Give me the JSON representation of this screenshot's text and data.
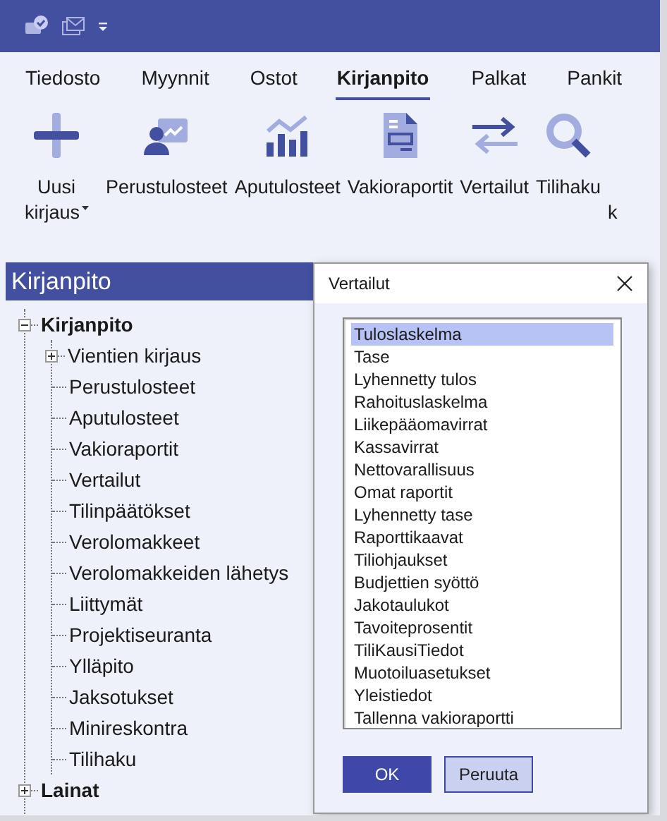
{
  "menu": [
    {
      "label": "Tiedosto",
      "selected": false
    },
    {
      "label": "Myynnit",
      "selected": false
    },
    {
      "label": "Ostot",
      "selected": false
    },
    {
      "label": "Kirjanpito",
      "selected": true
    },
    {
      "label": "Palkat",
      "selected": false
    },
    {
      "label": "Pankit",
      "selected": false
    }
  ],
  "toolbar": [
    {
      "label": "Uusi kirjaus",
      "dropdown": true
    },
    {
      "label": "Perustulosteet",
      "dropdown": false
    },
    {
      "label": "Aputulosteet",
      "dropdown": false
    },
    {
      "label": "Vakioraportit",
      "dropdown": false
    },
    {
      "label": "Vertailut",
      "dropdown": false
    },
    {
      "label": "Tilihaku",
      "dropdown": false
    },
    {
      "label": "k",
      "dropdown": false
    }
  ],
  "sidebar": {
    "title": "Kirjanpito",
    "tree": [
      {
        "label": "Kirjanpito",
        "expanded": true,
        "children": [
          {
            "label": "Vientien kirjaus",
            "expanded": false
          },
          {
            "label": "Perustulosteet"
          },
          {
            "label": "Aputulosteet"
          },
          {
            "label": "Vakioraportit"
          },
          {
            "label": "Vertailut"
          },
          {
            "label": "Tilinpäätökset"
          },
          {
            "label": "Verolomakkeet"
          },
          {
            "label": "Verolomakkeiden lähetys"
          },
          {
            "label": "Liittymät"
          },
          {
            "label": "Projektiseuranta"
          },
          {
            "label": "Ylläpito"
          },
          {
            "label": "Jaksotukset"
          },
          {
            "label": "Minireskontra"
          },
          {
            "label": "Tilihaku"
          }
        ]
      },
      {
        "label": "Lainat",
        "expanded": false
      }
    ]
  },
  "dialog": {
    "title": "Vertailut",
    "items": [
      {
        "label": "Tuloslaskelma",
        "selected": true
      },
      {
        "label": "Tase",
        "selected": false
      },
      {
        "label": "Lyhennetty tulos",
        "selected": false
      },
      {
        "label": "Rahoituslaskelma",
        "selected": false
      },
      {
        "label": "Liikepääomavirrat",
        "selected": false
      },
      {
        "label": "Kassavirrat",
        "selected": false
      },
      {
        "label": "Nettovarallisuus",
        "selected": false
      },
      {
        "label": "Omat raportit",
        "selected": false
      },
      {
        "label": "Lyhennetty tase",
        "selected": false
      },
      {
        "label": "Raporttikaavat",
        "selected": false
      },
      {
        "label": "Tiliohjaukset",
        "selected": false
      },
      {
        "label": "Budjettien syöttö",
        "selected": false
      },
      {
        "label": "Jakotaulukot",
        "selected": false
      },
      {
        "label": "Tavoiteprosentit",
        "selected": false
      },
      {
        "label": "TiliKausiTiedot",
        "selected": false
      },
      {
        "label": "Muotoiluasetukset",
        "selected": false
      },
      {
        "label": "Yleistiedot",
        "selected": false
      },
      {
        "label": "Tallenna vakioraportti",
        "selected": false
      }
    ],
    "buttons": [
      {
        "label": "OK",
        "kind": "primary"
      },
      {
        "label": "Peruuta",
        "kind": "secondary"
      }
    ]
  }
}
